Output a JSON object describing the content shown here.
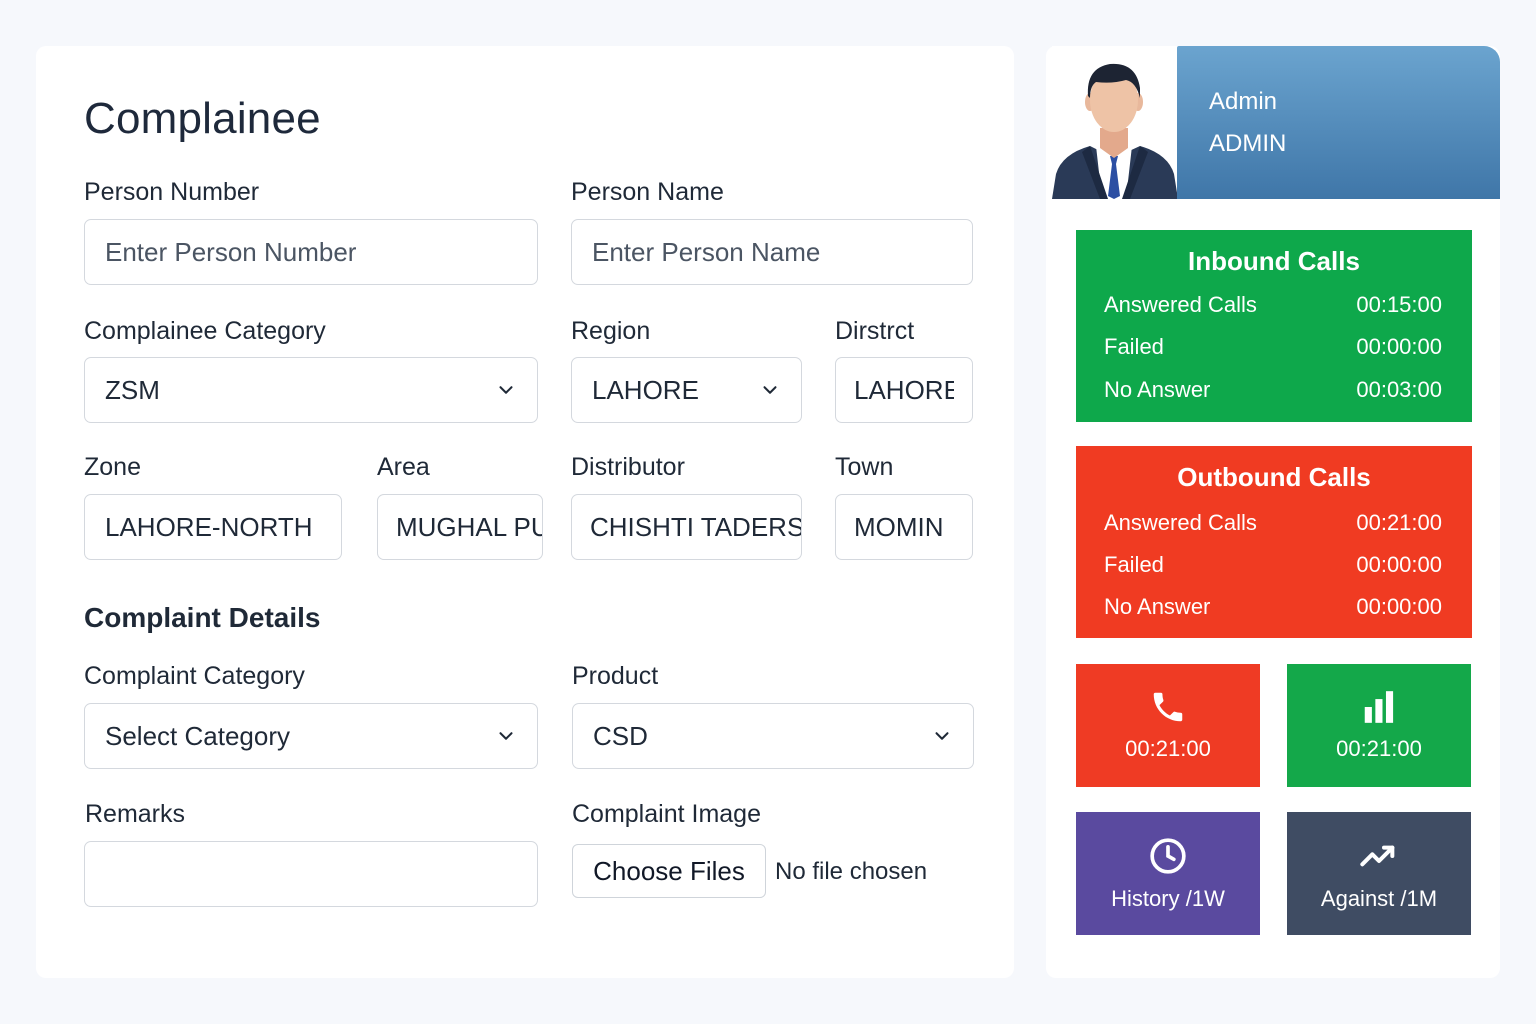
{
  "form": {
    "title": "Complainee",
    "person_number": {
      "label": "Person Number",
      "placeholder": "Enter Person Number"
    },
    "person_name": {
      "label": "Person Name",
      "placeholder": "Enter Person Name"
    },
    "complainee_category": {
      "label": "Complainee Category",
      "value": "ZSM"
    },
    "region": {
      "label": "Region",
      "value": "LAHORE"
    },
    "district": {
      "label": "Dirstrct",
      "value": "LAHORE"
    },
    "zone": {
      "label": "Zone",
      "value": "LAHORE-NORTH"
    },
    "area": {
      "label": "Area",
      "value": "MUGHAL PURA"
    },
    "distributor": {
      "label": "Distributor",
      "value": "CHISHTI TADERS"
    },
    "town": {
      "label": "Town",
      "value": "MOMIN"
    },
    "complaint_details_title": "Complaint Details",
    "complaint_category": {
      "label": "Complaint Category",
      "value": "Select Category"
    },
    "product": {
      "label": "Product",
      "value": "CSD"
    },
    "remarks": {
      "label": "Remarks",
      "value": ""
    },
    "complaint_image": {
      "label": "Complaint Image",
      "button": "Choose Files",
      "status": "No file chosen"
    }
  },
  "user": {
    "name": "Admin",
    "role": "ADMIN"
  },
  "inbound": {
    "title": "Inbound Calls",
    "rows": [
      {
        "label": "Answered Calls",
        "value": "00:15:00"
      },
      {
        "label": "Failed",
        "value": "00:00:00"
      },
      {
        "label": "No Answer",
        "value": "00:03:00"
      }
    ]
  },
  "outbound": {
    "title": "Outbound Calls",
    "rows": [
      {
        "label": "Answered Calls",
        "value": "00:21:00"
      },
      {
        "label": "Failed",
        "value": "00:00:00"
      },
      {
        "label": "No Answer",
        "value": "00:00:00"
      }
    ]
  },
  "tiles": [
    {
      "icon": "phone-icon",
      "text": "00:21:00",
      "color": "#ef3b24"
    },
    {
      "icon": "bar-chart-icon",
      "text": "00:21:00",
      "color": "#14a84a"
    },
    {
      "icon": "clock-icon",
      "text": "History /1W",
      "color": "#5a4a9f"
    },
    {
      "icon": "trend-up-icon",
      "text": "Against /1M",
      "color": "#3f4c63"
    }
  ],
  "colors": {
    "inbound": "#0ea84b",
    "outbound": "#f03b22",
    "user_band": "#4f86b8"
  }
}
